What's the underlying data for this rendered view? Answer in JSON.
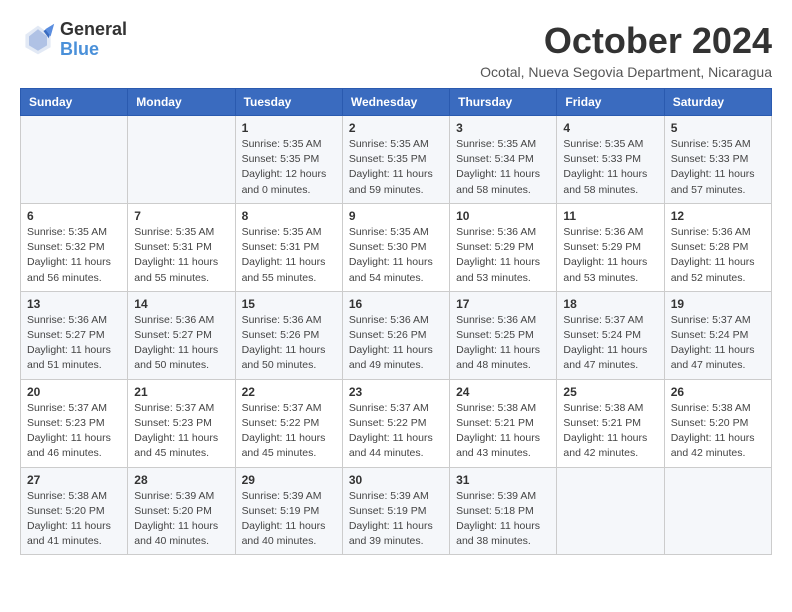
{
  "header": {
    "logo_line1": "General",
    "logo_line2": "Blue",
    "month": "October 2024",
    "location": "Ocotal, Nueva Segovia Department, Nicaragua"
  },
  "weekdays": [
    "Sunday",
    "Monday",
    "Tuesday",
    "Wednesday",
    "Thursday",
    "Friday",
    "Saturday"
  ],
  "weeks": [
    [
      {
        "day": "",
        "info": ""
      },
      {
        "day": "",
        "info": ""
      },
      {
        "day": "1",
        "info": "Sunrise: 5:35 AM\nSunset: 5:35 PM\nDaylight: 12 hours\nand 0 minutes."
      },
      {
        "day": "2",
        "info": "Sunrise: 5:35 AM\nSunset: 5:35 PM\nDaylight: 11 hours\nand 59 minutes."
      },
      {
        "day": "3",
        "info": "Sunrise: 5:35 AM\nSunset: 5:34 PM\nDaylight: 11 hours\nand 58 minutes."
      },
      {
        "day": "4",
        "info": "Sunrise: 5:35 AM\nSunset: 5:33 PM\nDaylight: 11 hours\nand 58 minutes."
      },
      {
        "day": "5",
        "info": "Sunrise: 5:35 AM\nSunset: 5:33 PM\nDaylight: 11 hours\nand 57 minutes."
      }
    ],
    [
      {
        "day": "6",
        "info": "Sunrise: 5:35 AM\nSunset: 5:32 PM\nDaylight: 11 hours\nand 56 minutes."
      },
      {
        "day": "7",
        "info": "Sunrise: 5:35 AM\nSunset: 5:31 PM\nDaylight: 11 hours\nand 55 minutes."
      },
      {
        "day": "8",
        "info": "Sunrise: 5:35 AM\nSunset: 5:31 PM\nDaylight: 11 hours\nand 55 minutes."
      },
      {
        "day": "9",
        "info": "Sunrise: 5:35 AM\nSunset: 5:30 PM\nDaylight: 11 hours\nand 54 minutes."
      },
      {
        "day": "10",
        "info": "Sunrise: 5:36 AM\nSunset: 5:29 PM\nDaylight: 11 hours\nand 53 minutes."
      },
      {
        "day": "11",
        "info": "Sunrise: 5:36 AM\nSunset: 5:29 PM\nDaylight: 11 hours\nand 53 minutes."
      },
      {
        "day": "12",
        "info": "Sunrise: 5:36 AM\nSunset: 5:28 PM\nDaylight: 11 hours\nand 52 minutes."
      }
    ],
    [
      {
        "day": "13",
        "info": "Sunrise: 5:36 AM\nSunset: 5:27 PM\nDaylight: 11 hours\nand 51 minutes."
      },
      {
        "day": "14",
        "info": "Sunrise: 5:36 AM\nSunset: 5:27 PM\nDaylight: 11 hours\nand 50 minutes."
      },
      {
        "day": "15",
        "info": "Sunrise: 5:36 AM\nSunset: 5:26 PM\nDaylight: 11 hours\nand 50 minutes."
      },
      {
        "day": "16",
        "info": "Sunrise: 5:36 AM\nSunset: 5:26 PM\nDaylight: 11 hours\nand 49 minutes."
      },
      {
        "day": "17",
        "info": "Sunrise: 5:36 AM\nSunset: 5:25 PM\nDaylight: 11 hours\nand 48 minutes."
      },
      {
        "day": "18",
        "info": "Sunrise: 5:37 AM\nSunset: 5:24 PM\nDaylight: 11 hours\nand 47 minutes."
      },
      {
        "day": "19",
        "info": "Sunrise: 5:37 AM\nSunset: 5:24 PM\nDaylight: 11 hours\nand 47 minutes."
      }
    ],
    [
      {
        "day": "20",
        "info": "Sunrise: 5:37 AM\nSunset: 5:23 PM\nDaylight: 11 hours\nand 46 minutes."
      },
      {
        "day": "21",
        "info": "Sunrise: 5:37 AM\nSunset: 5:23 PM\nDaylight: 11 hours\nand 45 minutes."
      },
      {
        "day": "22",
        "info": "Sunrise: 5:37 AM\nSunset: 5:22 PM\nDaylight: 11 hours\nand 45 minutes."
      },
      {
        "day": "23",
        "info": "Sunrise: 5:37 AM\nSunset: 5:22 PM\nDaylight: 11 hours\nand 44 minutes."
      },
      {
        "day": "24",
        "info": "Sunrise: 5:38 AM\nSunset: 5:21 PM\nDaylight: 11 hours\nand 43 minutes."
      },
      {
        "day": "25",
        "info": "Sunrise: 5:38 AM\nSunset: 5:21 PM\nDaylight: 11 hours\nand 42 minutes."
      },
      {
        "day": "26",
        "info": "Sunrise: 5:38 AM\nSunset: 5:20 PM\nDaylight: 11 hours\nand 42 minutes."
      }
    ],
    [
      {
        "day": "27",
        "info": "Sunrise: 5:38 AM\nSunset: 5:20 PM\nDaylight: 11 hours\nand 41 minutes."
      },
      {
        "day": "28",
        "info": "Sunrise: 5:39 AM\nSunset: 5:20 PM\nDaylight: 11 hours\nand 40 minutes."
      },
      {
        "day": "29",
        "info": "Sunrise: 5:39 AM\nSunset: 5:19 PM\nDaylight: 11 hours\nand 40 minutes."
      },
      {
        "day": "30",
        "info": "Sunrise: 5:39 AM\nSunset: 5:19 PM\nDaylight: 11 hours\nand 39 minutes."
      },
      {
        "day": "31",
        "info": "Sunrise: 5:39 AM\nSunset: 5:18 PM\nDaylight: 11 hours\nand 38 minutes."
      },
      {
        "day": "",
        "info": ""
      },
      {
        "day": "",
        "info": ""
      }
    ]
  ]
}
